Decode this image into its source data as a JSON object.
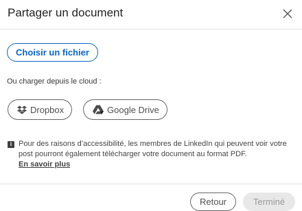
{
  "dialog": {
    "title": "Partager un document",
    "close_icon": "close-icon"
  },
  "upload": {
    "choose_file_label": "Choisir un fichier",
    "cloud_label": "Ou charger depuis le cloud :",
    "dropbox_label": "Dropbox",
    "dropbox_icon": "dropbox-icon",
    "google_drive_label": "Google Drive",
    "google_drive_icon": "google-drive-icon"
  },
  "info": {
    "icon": "info-icon",
    "icon_glyph": "i",
    "text": "Pour des raisons d’accessibilité, les membres de LinkedIn qui peuvent voir votre post pourront également télécharger votre document au format PDF.",
    "learn_more_label": "En savoir plus"
  },
  "footer": {
    "back_label": "Retour",
    "done_label": "Terminé"
  },
  "colors": {
    "accent": "#0a66c2",
    "disabled_bg": "#e8e8e8"
  }
}
